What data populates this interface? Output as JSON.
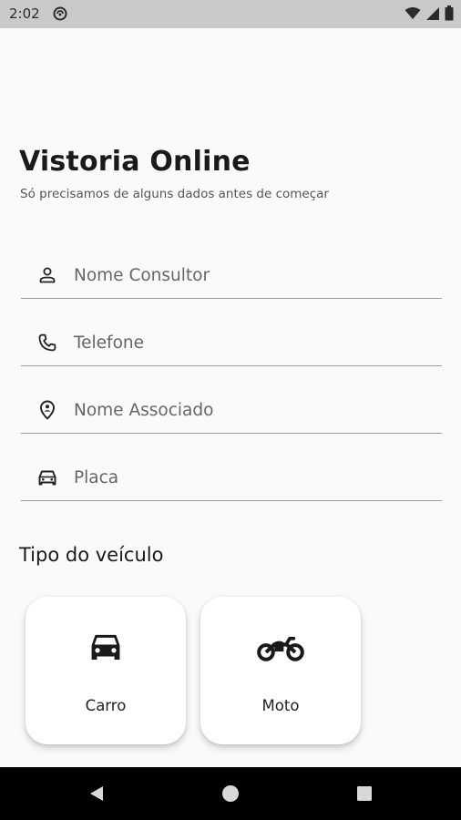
{
  "status_bar": {
    "time": "2:02",
    "icons": [
      "do-not-disturb-icon",
      "wifi-icon",
      "cellular-signal-icon",
      "battery-icon"
    ]
  },
  "header": {
    "title": "Vistoria Online",
    "subtitle": "Só precisamos de alguns dados antes de começar"
  },
  "form": {
    "fields": [
      {
        "name": "nome-consultor",
        "placeholder": "Nome Consultor",
        "value": "",
        "icon": "person-icon"
      },
      {
        "name": "telefone",
        "placeholder": "Telefone",
        "value": "",
        "icon": "phone-icon"
      },
      {
        "name": "nome-associado",
        "placeholder": "Nome Associado",
        "value": "",
        "icon": "location-person-icon"
      },
      {
        "name": "placa",
        "placeholder": "Placa",
        "value": "",
        "icon": "car-icon"
      }
    ]
  },
  "vehicle_type": {
    "title": "Tipo do veículo",
    "options": [
      {
        "label": "Carro",
        "icon": "car-icon"
      },
      {
        "label": "Moto",
        "icon": "motorcycle-icon"
      }
    ]
  },
  "nav_bar": {
    "buttons": [
      "back-icon",
      "home-icon",
      "recents-icon"
    ]
  },
  "colors": {
    "background": "#fafafa",
    "status_bar": "#c9c9c9",
    "nav_bar": "#000000",
    "card": "#ffffff",
    "divider": "#9e9e9e"
  }
}
